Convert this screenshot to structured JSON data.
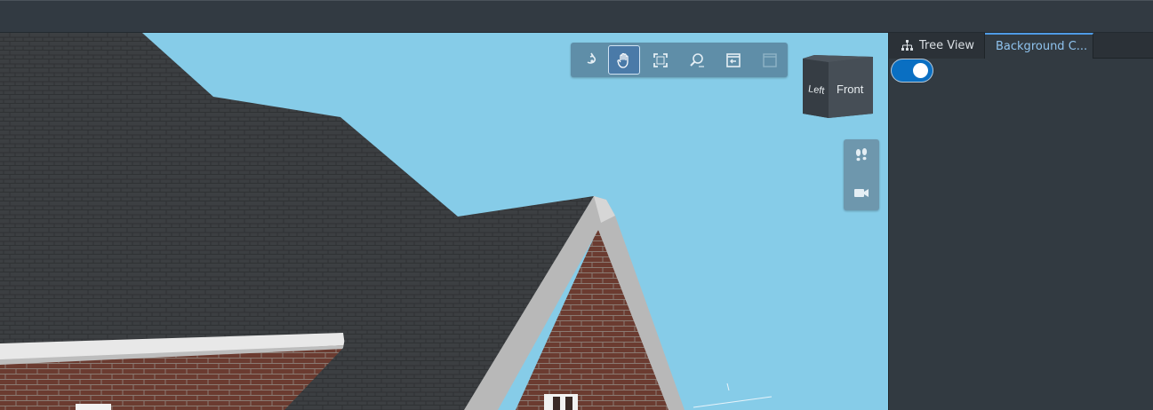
{
  "viewer": {
    "toolbar": {
      "tools": [
        {
          "icon": "orbit-icon",
          "active": false
        },
        {
          "icon": "pan-hand-icon",
          "active": true
        },
        {
          "icon": "fit-to-view-icon",
          "active": false
        },
        {
          "icon": "zoom-icon",
          "active": false
        },
        {
          "icon": "home-view-icon",
          "active": false
        },
        {
          "icon": "section-box-icon",
          "active": false,
          "disabled": true
        }
      ]
    },
    "view_cube": {
      "left_label": "Left",
      "front_label": "Front"
    },
    "navigation": {
      "buttons": [
        {
          "icon": "walk-footprints-icon"
        },
        {
          "icon": "camera-icon"
        }
      ]
    },
    "sky_color": "#86cce8"
  },
  "side_panel": {
    "tabs": [
      {
        "label": "Tree View",
        "icon": "hierarchy-icon",
        "active": false
      },
      {
        "label": "Background C...",
        "active": true
      }
    ],
    "toggle": {
      "on": true,
      "color": "#0a6fc2"
    }
  }
}
